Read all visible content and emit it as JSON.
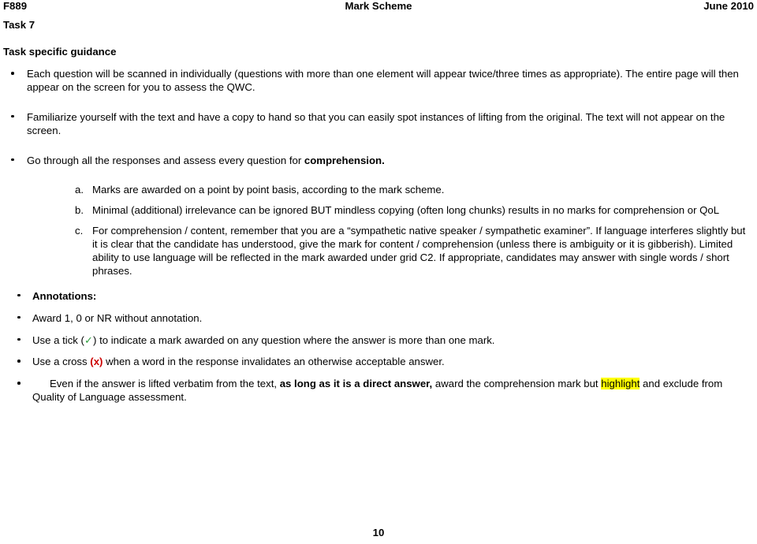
{
  "header": {
    "left": "F889",
    "center": "Mark Scheme",
    "right": "June 2010"
  },
  "task_label": "Task 7",
  "section_title": "Task specific guidance",
  "bullets": {
    "b1_part1": "Each question will be scanned in individually (questions with more than one element will appear twice/three times as appropriate). The entire page will then appear on the screen for you to assess the QWC.",
    "b2_part1": "Familiarize yourself with the text and have a copy to hand so that you can easily spot instances of lifting from the original. The text will not appear on the screen.",
    "b3_prefix": "Go through all the responses and assess every question for ",
    "b3_bold": "comprehension.",
    "annotations_label": "Annotations:",
    "b5": "Award 1, 0 or NR without annotation.",
    "b6_prefix": "Use a tick (",
    "b6_tick": "✓",
    "b6_suffix": ") to indicate a mark awarded on any question where the answer is more than one mark.",
    "b7_prefix": "Use a cross ",
    "b7_cross": "(x)",
    "b7_suffix": " when a word in the response invalidates an otherwise acceptable answer.",
    "b8_prefix": "Even if the answer is lifted verbatim from the text, ",
    "b8_bold": "as long as it is a direct answer,",
    "b8_mid": " award the comprehension mark but ",
    "b8_highlight": "highlight",
    "b8_suffix": " and exclude from Quality of Language assessment."
  },
  "letter_items": {
    "a_marker": "a.",
    "a_text": "Marks are awarded on a point by point basis, according to the mark scheme.",
    "b_marker": "b.",
    "b_text": "Minimal (additional) irrelevance can be ignored BUT mindless copying (often long chunks) results in no marks for comprehension or QoL",
    "c_marker": "c.",
    "c_text": "For comprehension / content, remember that you are a “sympathetic native speaker / sympathetic examiner”. If language interferes slightly but it is clear that the candidate has understood, give the mark for content / comprehension (unless there is ambiguity or it is gibberish). Limited ability to use language will be reflected in the mark awarded under grid C2. If appropriate, candidates may answer with single words / short phrases."
  },
  "page_number": "10",
  "colors": {
    "tick_green": "#2e9e3e",
    "cross_red": "#cc0000",
    "highlight_yellow": "#ffff00",
    "text_black": "#000000"
  }
}
